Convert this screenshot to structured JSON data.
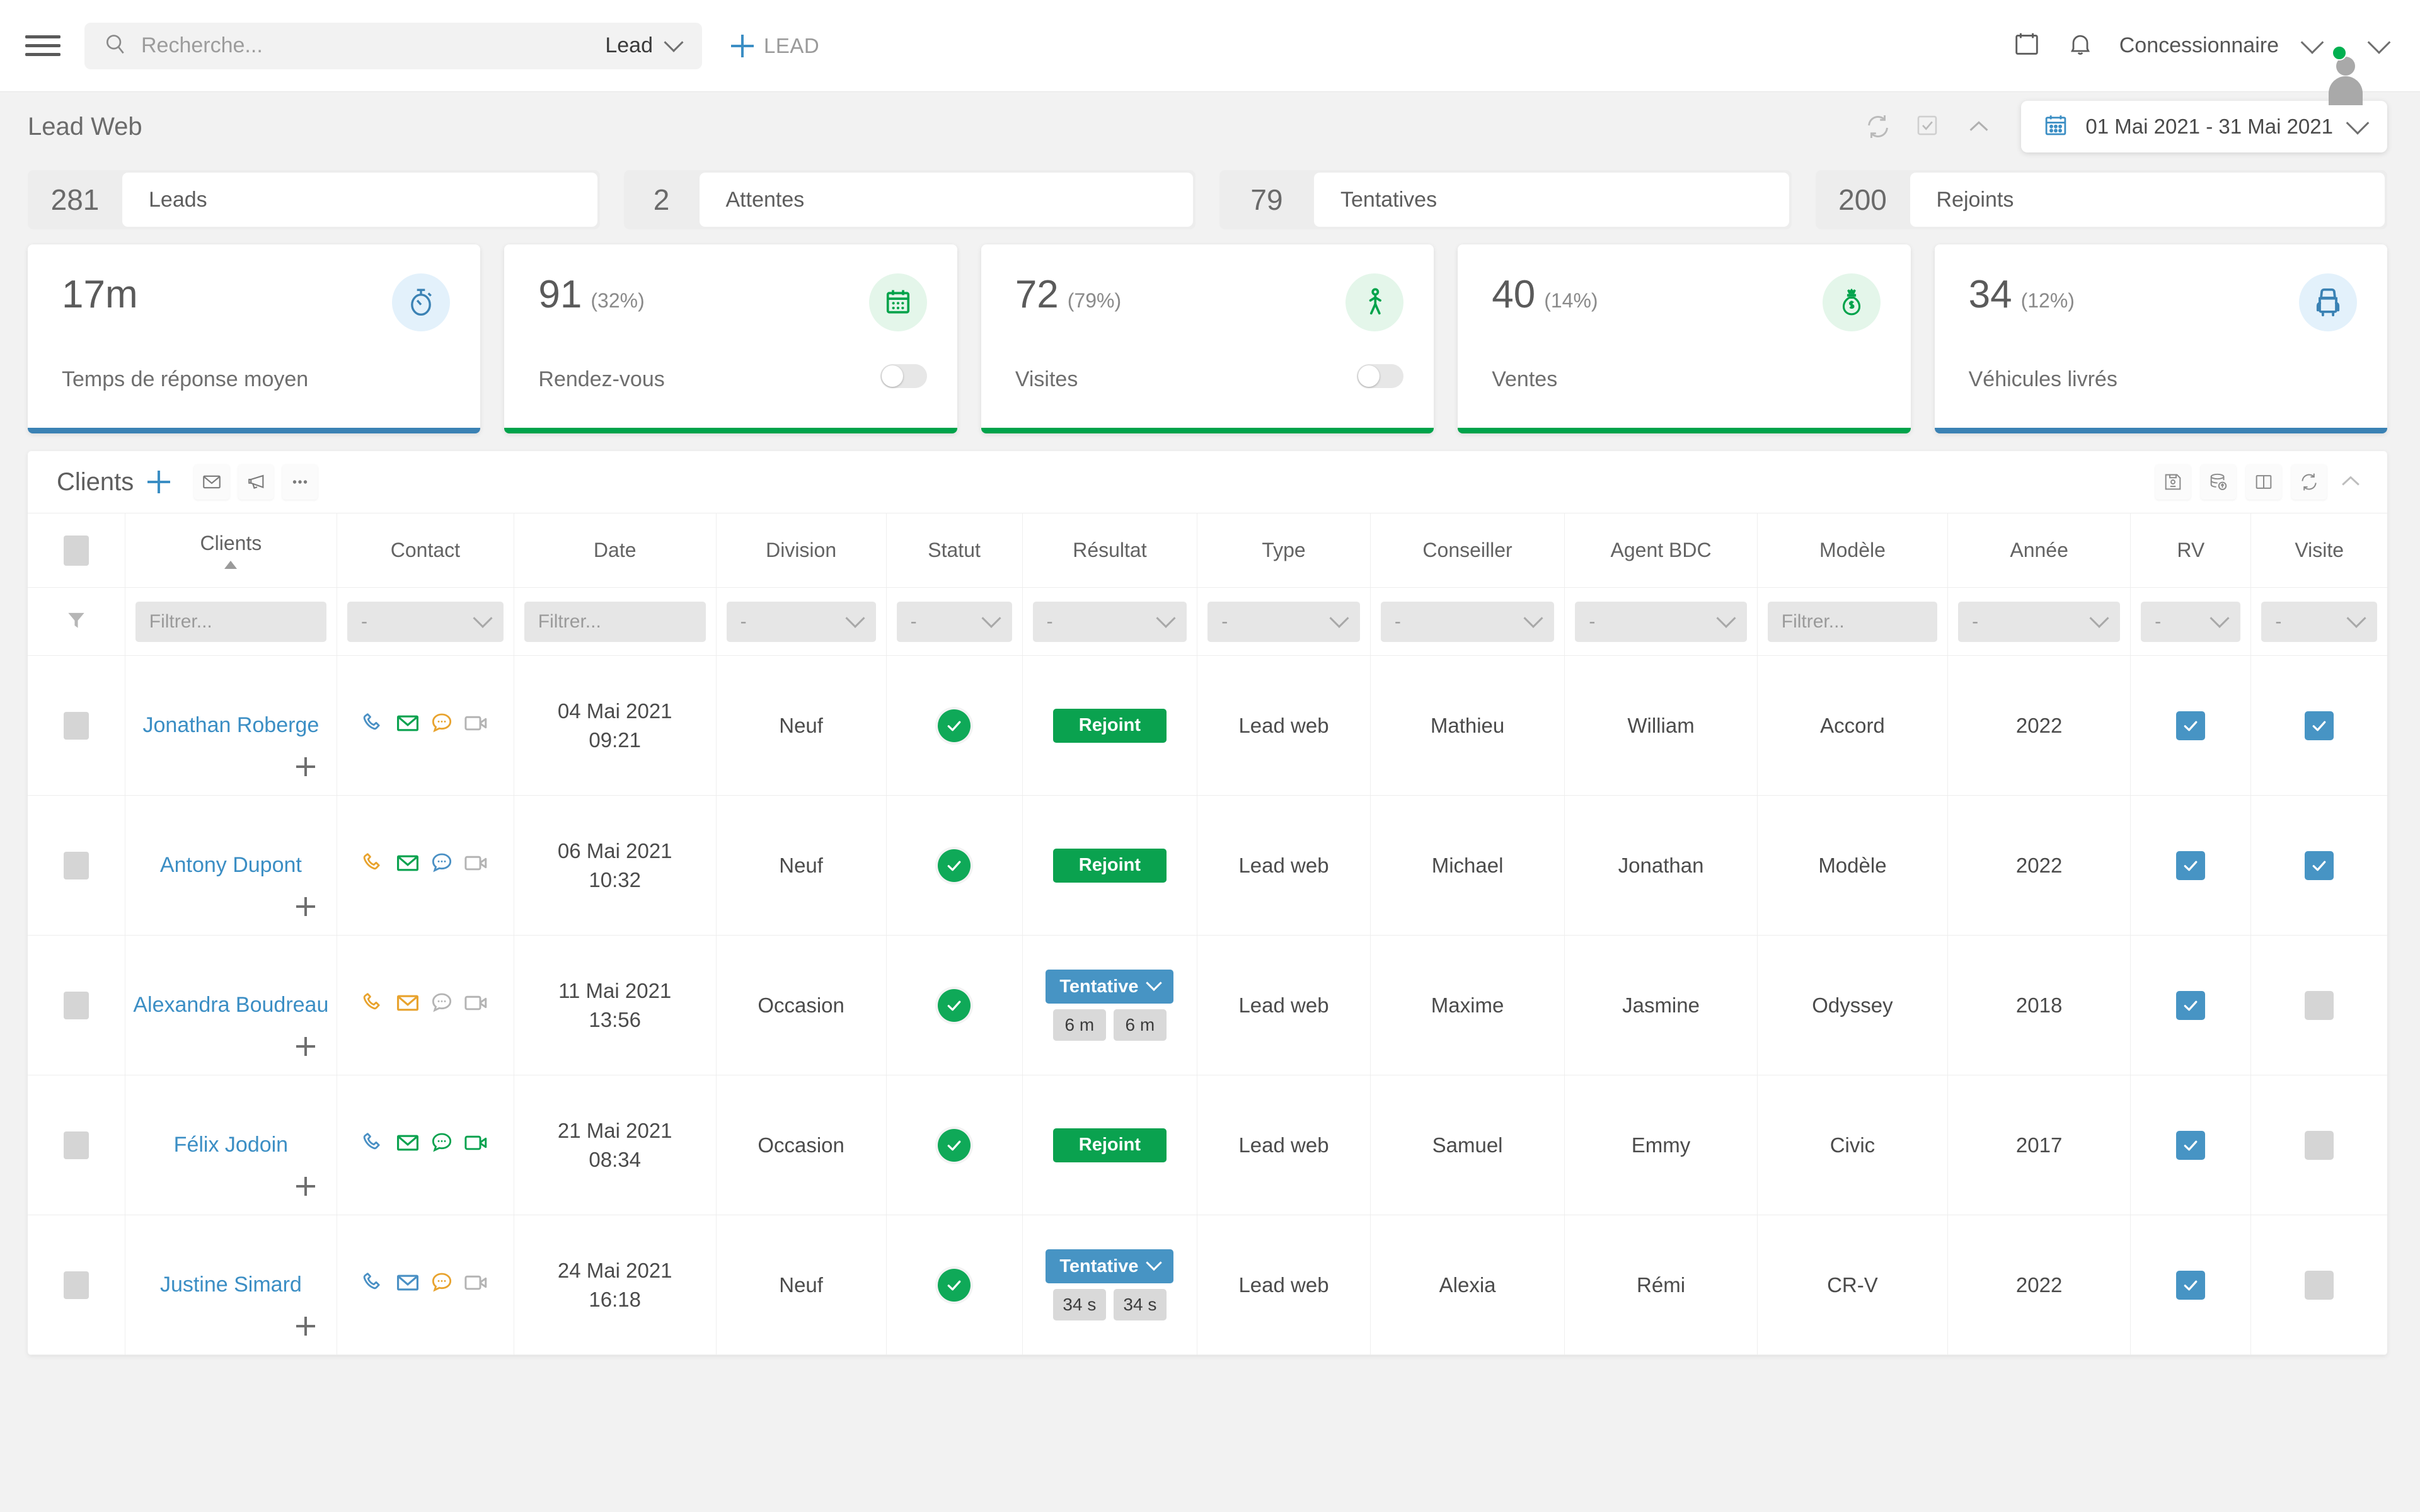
{
  "topbar": {
    "menu_icon": "hamburger-icon",
    "search": {
      "placeholder": "Recherche...",
      "value": "",
      "scope": "Lead"
    },
    "add_lead_label": "LEAD",
    "calendar_icon": "calendar-icon",
    "bell_icon": "bell-icon",
    "user_name": "Concessionnaire"
  },
  "page": {
    "title": "Lead Web",
    "date_range": "01 Mai 2021 - 31 Mai 2021",
    "head_icons": [
      "refresh-icon",
      "checkbox-icon",
      "collapse-chevron-icon"
    ]
  },
  "stats": [
    {
      "value": "281",
      "label": "Leads"
    },
    {
      "value": "2",
      "label": "Attentes"
    },
    {
      "value": "79",
      "label": "Tentatives"
    },
    {
      "value": "200",
      "label": "Rejoints"
    }
  ],
  "kpis": [
    {
      "value": "17m",
      "pct": "",
      "caption": "Temps de réponse moyen",
      "icon": "stopwatch-icon",
      "accent": "#3b82b4",
      "tint": "#e3f1fb",
      "toggle": false
    },
    {
      "value": "91",
      "pct": "(32%)",
      "caption": "Rendez-vous",
      "icon": "calendar-icon",
      "accent": "#00a34b",
      "tint": "#e4f6ea",
      "toggle": true
    },
    {
      "value": "72",
      "pct": "(79%)",
      "caption": "Visites",
      "icon": "walking-person-icon",
      "accent": "#00a34b",
      "tint": "#e4f6ea",
      "toggle": true
    },
    {
      "value": "40",
      "pct": "(14%)",
      "caption": "Ventes",
      "icon": "money-bag-icon",
      "accent": "#00a34b",
      "tint": "#e4f6ea",
      "toggle": false
    },
    {
      "value": "34",
      "pct": "(12%)",
      "caption": "Véhicules livrés",
      "icon": "car-icon",
      "accent": "#3b82b4",
      "tint": "#e3f1fb",
      "toggle": false
    }
  ],
  "panel": {
    "title": "Clients",
    "left_buttons": [
      "envelope-icon",
      "megaphone-icon",
      "ellipsis-icon"
    ],
    "right_buttons": [
      "save-icon",
      "database-upload-icon",
      "split-view-icon",
      "refresh-icon",
      "collapse-chevron-icon"
    ]
  },
  "table": {
    "columns": [
      "Clients",
      "Contact",
      "Date",
      "Division",
      "Statut",
      "Résultat",
      "Type",
      "Conseiller",
      "Agent BDC",
      "Modèle",
      "Année",
      "RV",
      "Visite"
    ],
    "sorted_column": "Clients",
    "filters": {
      "clients": "Filtrer...",
      "contact": "-",
      "date": "Filtrer...",
      "division": "-",
      "statut": "-",
      "resultat": "-",
      "type": "-",
      "conseiller": "-",
      "agent_bdc": "-",
      "modele": "Filtrer...",
      "annee": "-",
      "rv": "-",
      "visite": "-"
    },
    "rows": [
      {
        "client": "Jonathan Roberge",
        "contacts": [
          {
            "icon": "phone-icon",
            "color": "#4a90c4"
          },
          {
            "icon": "envelope-icon",
            "color": "#0aa24f"
          },
          {
            "icon": "chat-bubble-icon",
            "color": "#e8a32e"
          },
          {
            "icon": "video-camera-icon",
            "color": "#b4b4b4"
          }
        ],
        "date": "04 Mai 2021",
        "time": "09:21",
        "division": "Neuf",
        "statut": "check",
        "resultat": {
          "label": "Rejoint",
          "kind": "green",
          "chips": []
        },
        "type": "Lead web",
        "conseiller": "Mathieu",
        "agent_bdc": "William",
        "modele": "Accord",
        "annee": "2022",
        "rv": true,
        "visite": true
      },
      {
        "client": "Antony Dupont",
        "contacts": [
          {
            "icon": "phone-icon",
            "color": "#e8a32e"
          },
          {
            "icon": "envelope-icon",
            "color": "#0aa24f"
          },
          {
            "icon": "chat-bubble-icon",
            "color": "#4a90c4"
          },
          {
            "icon": "video-camera-icon",
            "color": "#b4b4b4"
          }
        ],
        "date": "06 Mai 2021",
        "time": "10:32",
        "division": "Neuf",
        "statut": "check",
        "resultat": {
          "label": "Rejoint",
          "kind": "green",
          "chips": []
        },
        "type": "Lead web",
        "conseiller": "Michael",
        "agent_bdc": "Jonathan",
        "modele": "Modèle",
        "annee": "2022",
        "rv": true,
        "visite": true
      },
      {
        "client": "Alexandra Boudreau",
        "contacts": [
          {
            "icon": "phone-icon",
            "color": "#e8a32e"
          },
          {
            "icon": "envelope-icon",
            "color": "#e8a32e"
          },
          {
            "icon": "chat-bubble-icon",
            "color": "#b4b4b4"
          },
          {
            "icon": "video-camera-icon",
            "color": "#b4b4b4"
          }
        ],
        "date": "11 Mai 2021",
        "time": "13:56",
        "division": "Occasion",
        "statut": "check",
        "resultat": {
          "label": "Tentative",
          "kind": "blue",
          "chips": [
            "6 m",
            "6 m"
          ]
        },
        "type": "Lead web",
        "conseiller": "Maxime",
        "agent_bdc": "Jasmine",
        "modele": "Odyssey",
        "annee": "2018",
        "rv": true,
        "visite": false
      },
      {
        "client": "Félix Jodoin",
        "contacts": [
          {
            "icon": "phone-icon",
            "color": "#4a90c4"
          },
          {
            "icon": "envelope-icon",
            "color": "#0aa24f"
          },
          {
            "icon": "chat-bubble-icon",
            "color": "#0aa24f"
          },
          {
            "icon": "video-camera-icon",
            "color": "#0aa24f"
          }
        ],
        "date": "21 Mai 2021",
        "time": "08:34",
        "division": "Occasion",
        "statut": "check",
        "resultat": {
          "label": "Rejoint",
          "kind": "green",
          "chips": []
        },
        "type": "Lead web",
        "conseiller": "Samuel",
        "agent_bdc": "Emmy",
        "modele": "Civic",
        "annee": "2017",
        "rv": true,
        "visite": false
      },
      {
        "client": "Justine Simard",
        "contacts": [
          {
            "icon": "phone-icon",
            "color": "#4a90c4"
          },
          {
            "icon": "envelope-icon",
            "color": "#4a90c4"
          },
          {
            "icon": "chat-bubble-icon",
            "color": "#e8a32e"
          },
          {
            "icon": "video-camera-icon",
            "color": "#b4b4b4"
          }
        ],
        "date": "24 Mai 2021",
        "time": "16:18",
        "division": "Neuf",
        "statut": "check",
        "resultat": {
          "label": "Tentative",
          "kind": "blue",
          "chips": [
            "34 s",
            "34 s"
          ]
        },
        "type": "Lead web",
        "conseiller": "Alexia",
        "agent_bdc": "Rémi",
        "modele": "CR-V",
        "annee": "2022",
        "rv": true,
        "visite": false
      }
    ]
  }
}
